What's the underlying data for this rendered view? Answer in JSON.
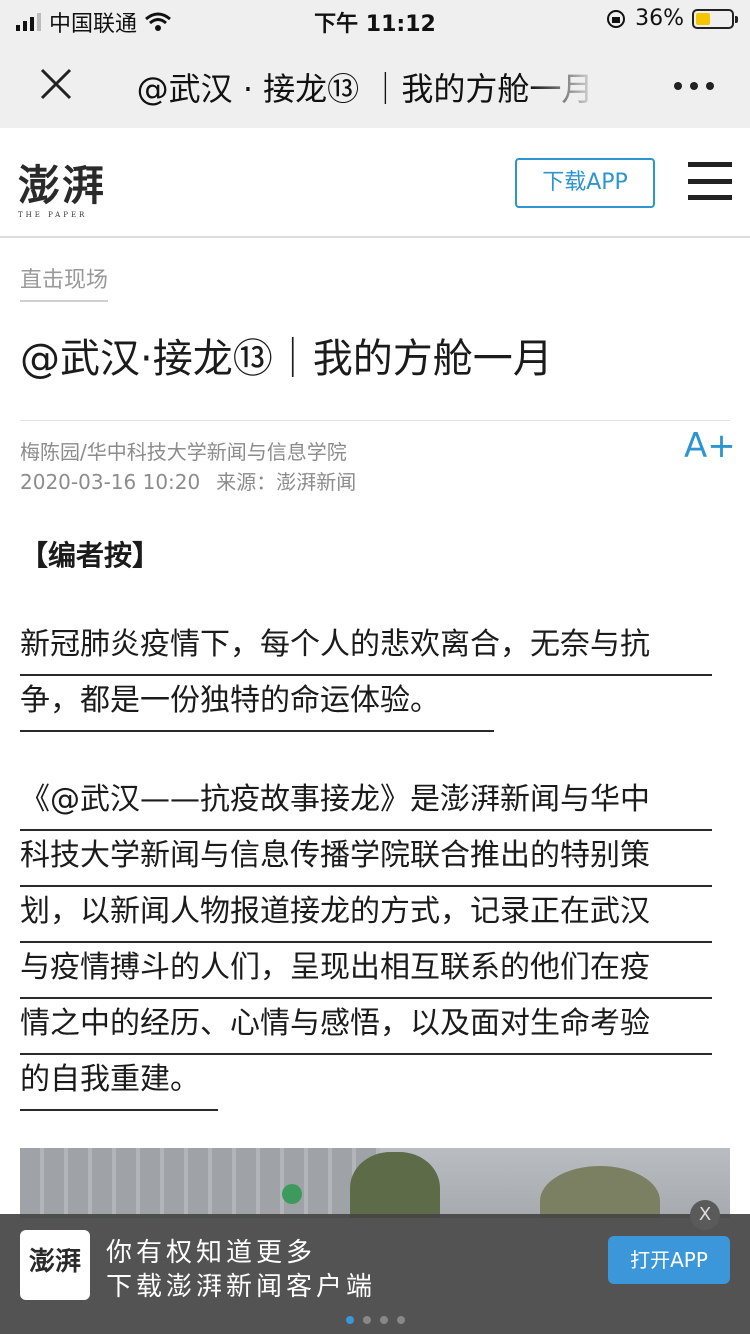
{
  "status_bar": {
    "carrier": "中国联通",
    "time": "下午 11:12",
    "battery": "36%"
  },
  "navbar": {
    "title": "@武汉 · 接龙⑬ ｜我的方舱一月"
  },
  "site": {
    "logo": "澎湃",
    "logo_sub": "THE PAPER",
    "download_label": "下载APP"
  },
  "article": {
    "category": "直击现场",
    "title": "@武汉·接龙⑬｜我的方舱一月",
    "author": "梅陈园/华中科技大学新闻与信息学院",
    "date": "2020-03-16 10:20",
    "source": "来源：澎湃新闻",
    "font_button": "A+",
    "editor_note": "【编者按】",
    "para1": [
      "新冠肺炎疫情下，每个人的悲欢离合，无奈与抗",
      "争，都是一份独特的命运体验。"
    ],
    "para2": [
      "《@武汉——抗疫故事接龙》是澎湃新闻与华中",
      "科技大学新闻与信息传播学院联合推出的特别策",
      "划，以新闻人物报道接龙的方式，记录正在武汉",
      "与疫情搏斗的人们，呈现出相互联系的他们在疫",
      "情之中的经历、心情与感悟，以及面对生命考验",
      "的自我重建。"
    ]
  },
  "banner": {
    "logo": "澎湃",
    "line1": "你有权知道更多",
    "line2": "下载澎湃新闻客户端",
    "open_label": "打开APP",
    "close_label": "X"
  },
  "colors": {
    "accent": "#2d95cf",
    "banner_bg": "#464646"
  }
}
